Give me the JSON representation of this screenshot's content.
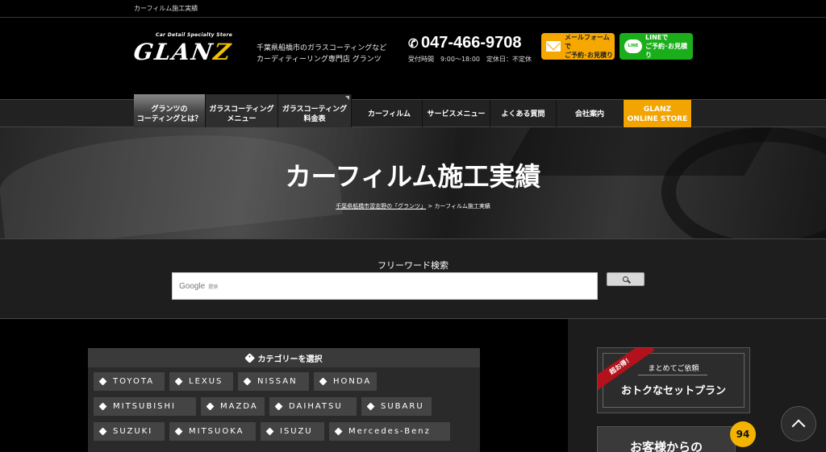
{
  "topbar": {
    "text": "カーフィルム施工実績"
  },
  "header": {
    "logo_sub": "Car Detail Specialty Store",
    "logo_main": "GLAN",
    "logo_z": "Z",
    "tagline_1": "千葉県船橋市のガラスコーティングなど",
    "tagline_2": "カーディティーリング専門店 グランツ",
    "phone": "047-466-9708",
    "hours": "受付時間　9:00〜18:00　定休日：不定休",
    "mail_cta_1": "メールフォームで",
    "mail_cta_2": "ご予約･お見積り",
    "line_icon": "LINE",
    "line_cta_1": "LINEで",
    "line_cta_2": "ご予約･お見積り"
  },
  "nav": {
    "items": [
      {
        "line1": "グランツの",
        "line2": "コーティングとは？"
      },
      {
        "line1": "ガラスコーティング",
        "line2": "メニュー"
      },
      {
        "line1": "ガラスコーティング",
        "line2": "料金表"
      },
      {
        "line1": "カーフィルム",
        "line2": ""
      },
      {
        "line1": "サービスメニュー",
        "line2": ""
      },
      {
        "line1": "よくある質問",
        "line2": ""
      },
      {
        "line1": "会社案内",
        "line2": ""
      },
      {
        "line1": "GLANZ",
        "line2": "ONLINE STORE"
      }
    ]
  },
  "hero": {
    "title": "カーフィルム施工実績",
    "breadcrumb_home": "千葉県船橋市習志野の「グランツ」",
    "breadcrumb_sep": ">",
    "breadcrumb_current": "カーフィルム施工実績"
  },
  "search": {
    "label": "フリーワード検索",
    "google": "Google",
    "provided": "提供"
  },
  "categories": {
    "heading": "カテゴリーを選択",
    "tags": [
      "TOYOTA",
      "LEXUS",
      "NISSAN",
      "HONDA",
      "MITSUBISHI",
      "MAZDA",
      "DAIHATSU",
      "SUBARU",
      "SUZUKI",
      "MITSUOKA",
      "ISUZU",
      "Mercedes-Benz"
    ]
  },
  "sidebar": {
    "ribbon": "超お得！",
    "promo_sub": "まとめてご依頼",
    "promo_main": "おトクなセットプラン",
    "reviews": "お客様からの",
    "badge": "94"
  },
  "colors": {
    "accent_orange": "#f2a500",
    "line_green": "#1aaf1a",
    "ribbon_red": "#b3121c"
  }
}
